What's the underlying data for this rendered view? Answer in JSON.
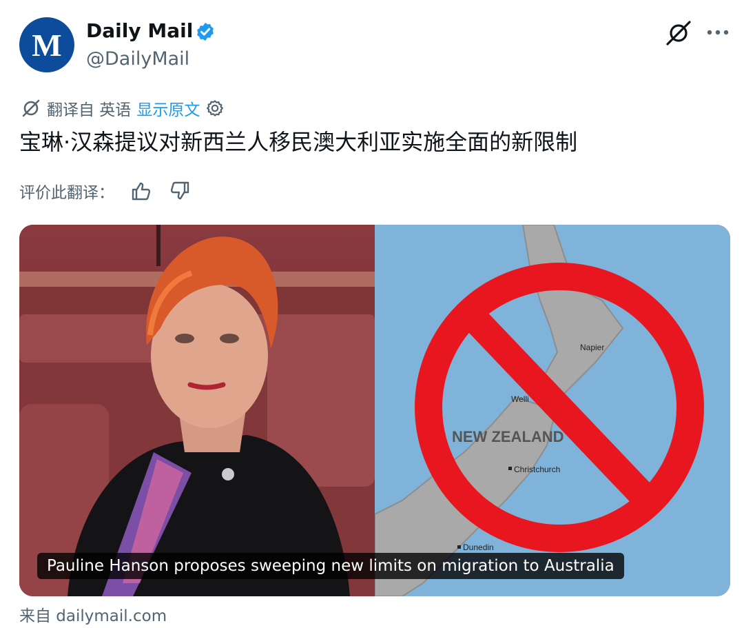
{
  "account": {
    "avatar_letter": "M",
    "display_name": "Daily Mail",
    "handle": "@DailyMail",
    "verified_icon": "verified-badge-icon",
    "brand_color": "#0d4c9b",
    "verified_color": "#1d9bf0"
  },
  "translation": {
    "translated_from": "翻译自 英语",
    "show_original": "显示原文",
    "link_color": "#1d9bf0"
  },
  "tweet": {
    "text": "宝琳·汉森提议对新西兰人移民澳大利亚实施全面的新限制"
  },
  "rating": {
    "label": "评价此翻译："
  },
  "card": {
    "caption": "Pauline Hanson proposes sweeping new limits on migration to Australia",
    "map_title": "NEW ZEALAND",
    "map_places": [
      "Napier",
      "Welli",
      "Christchurch",
      "Dunedin"
    ],
    "prohibition_color": "#e8171f"
  },
  "source": {
    "label": "来自 dailymail.com"
  },
  "icons": [
    "verified-badge-icon",
    "grok-icon",
    "more-icon",
    "translate-icon",
    "settings-icon",
    "thumbs-up-icon",
    "thumbs-down-icon"
  ]
}
